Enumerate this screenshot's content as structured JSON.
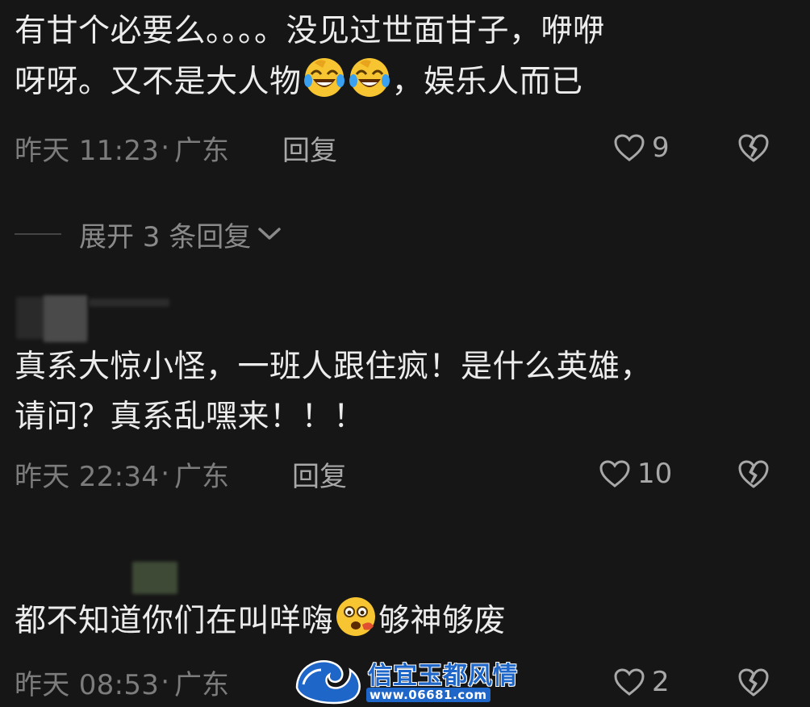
{
  "comments": [
    {
      "text_line1": "有甘个必要么。。。。没见过世面甘子，咿咿",
      "text_line2_a": "呀呀。又不是大人物",
      "text_line2_b": "，娱乐人而已",
      "emojis": [
        "laughing-tears-emoji",
        "laughing-tears-emoji"
      ],
      "time": "昨天 11:23",
      "sep": "·",
      "location": "广东",
      "reply_label": "回复",
      "like_count": "9"
    },
    {
      "text_line1": "真系大惊小怪，一班人跟住疯！是什么英雄，",
      "text_line2": "请问？真系乱嘿来！！！",
      "time": "昨天 22:34",
      "sep": "·",
      "location": "广东",
      "reply_label": "回复",
      "like_count": "10"
    },
    {
      "text_a": "都不知道你们在叫咩嗨",
      "text_b": "够神够废",
      "emojis": [
        "shocked-face-emoji"
      ],
      "time": "昨天 08:53",
      "sep": "·",
      "location": "广东",
      "like_count": "2"
    }
  ],
  "expand": {
    "label": "展开 3 条回复"
  },
  "watermark": {
    "title": "信宜玉都风情",
    "url": "www.06681.com"
  },
  "colors": {
    "background": "#161616",
    "text": "#ececec",
    "meta": "#7c7c7c",
    "accent_watermark": "#1f66c9"
  }
}
